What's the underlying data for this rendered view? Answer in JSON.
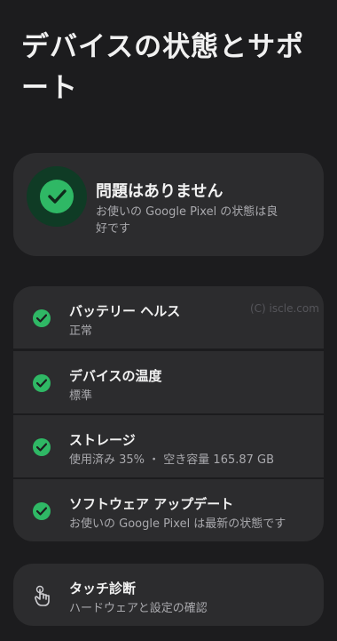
{
  "page": {
    "title": "デバイスの状態とサポート"
  },
  "status_card": {
    "title": "問題はありません",
    "description": "お使いの Google Pixel の状態は良好です",
    "icon": "check-circle-icon",
    "accent": "#2fb865"
  },
  "checks": [
    {
      "label": "バッテリー ヘルス",
      "sub": "正常",
      "icon": "check-circle-icon"
    },
    {
      "label": "デバイスの温度",
      "sub": "標準",
      "icon": "check-circle-icon"
    },
    {
      "label": "ストレージ",
      "sub": "使用済み 35% ・ 空き容量 165.87 GB",
      "icon": "check-circle-icon"
    },
    {
      "label": "ソフトウェア アップデート",
      "sub": "お使いの Google Pixel は最新の状態です",
      "icon": "check-circle-icon"
    }
  ],
  "watermark": "(C) iscle.com",
  "touch_diagnostics": {
    "label": "タッチ診断",
    "sub": "ハードウェアと設定の確認",
    "icon": "touch-hand-icon"
  }
}
